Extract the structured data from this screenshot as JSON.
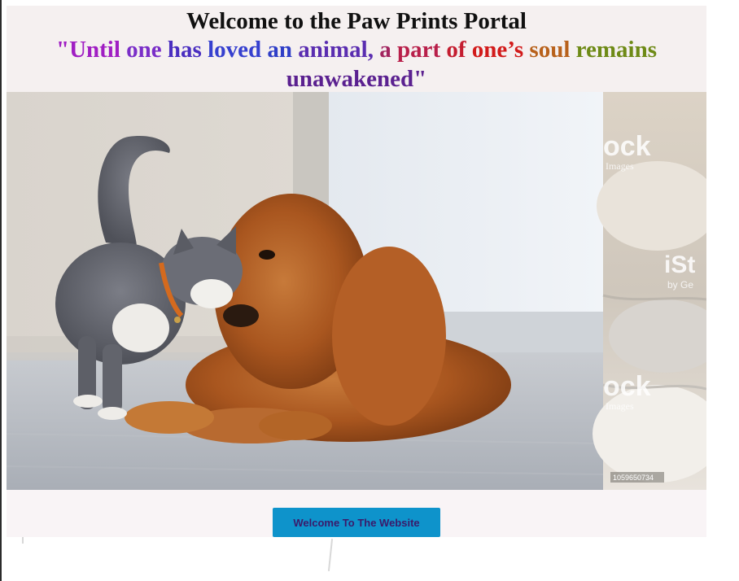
{
  "header": {
    "title": "Welcome to the Paw Prints Portal",
    "quote_words": [
      {
        "text": "\"Until",
        "color": "#a01ec3"
      },
      {
        "text": "one",
        "color": "#7a2ec8"
      },
      {
        "text": "has",
        "color": "#4a2ec0"
      },
      {
        "text": "loved",
        "color": "#3640cf"
      },
      {
        "text": "an",
        "color": "#2f3ec7"
      },
      {
        "text": "animal,",
        "color": "#5a2db0"
      },
      {
        "text": "a",
        "color": "#a2245f"
      },
      {
        "text": "part",
        "color": "#b81f4a"
      },
      {
        "text": "of",
        "color": "#c41d30"
      },
      {
        "text": "one’s",
        "color": "#d21b1b"
      },
      {
        "text": "soul",
        "color": "#b8611b"
      },
      {
        "text": "remains",
        "color": "#6e8a16"
      },
      {
        "text": "unawakened\"",
        "color": "#5b2190"
      }
    ]
  },
  "hero": {
    "watermark_primary": "ock",
    "watermark_secondary": "Images",
    "watermark_brand": "iSt",
    "watermark_brand_sub": "by Ge",
    "stock_id": "1059650734"
  },
  "actions": {
    "welcome_label": "Welcome To The Website"
  },
  "colors": {
    "header_bg": "#f5f0f0",
    "button_bg": "#0e93cb",
    "button_text": "#3b1a6a"
  }
}
